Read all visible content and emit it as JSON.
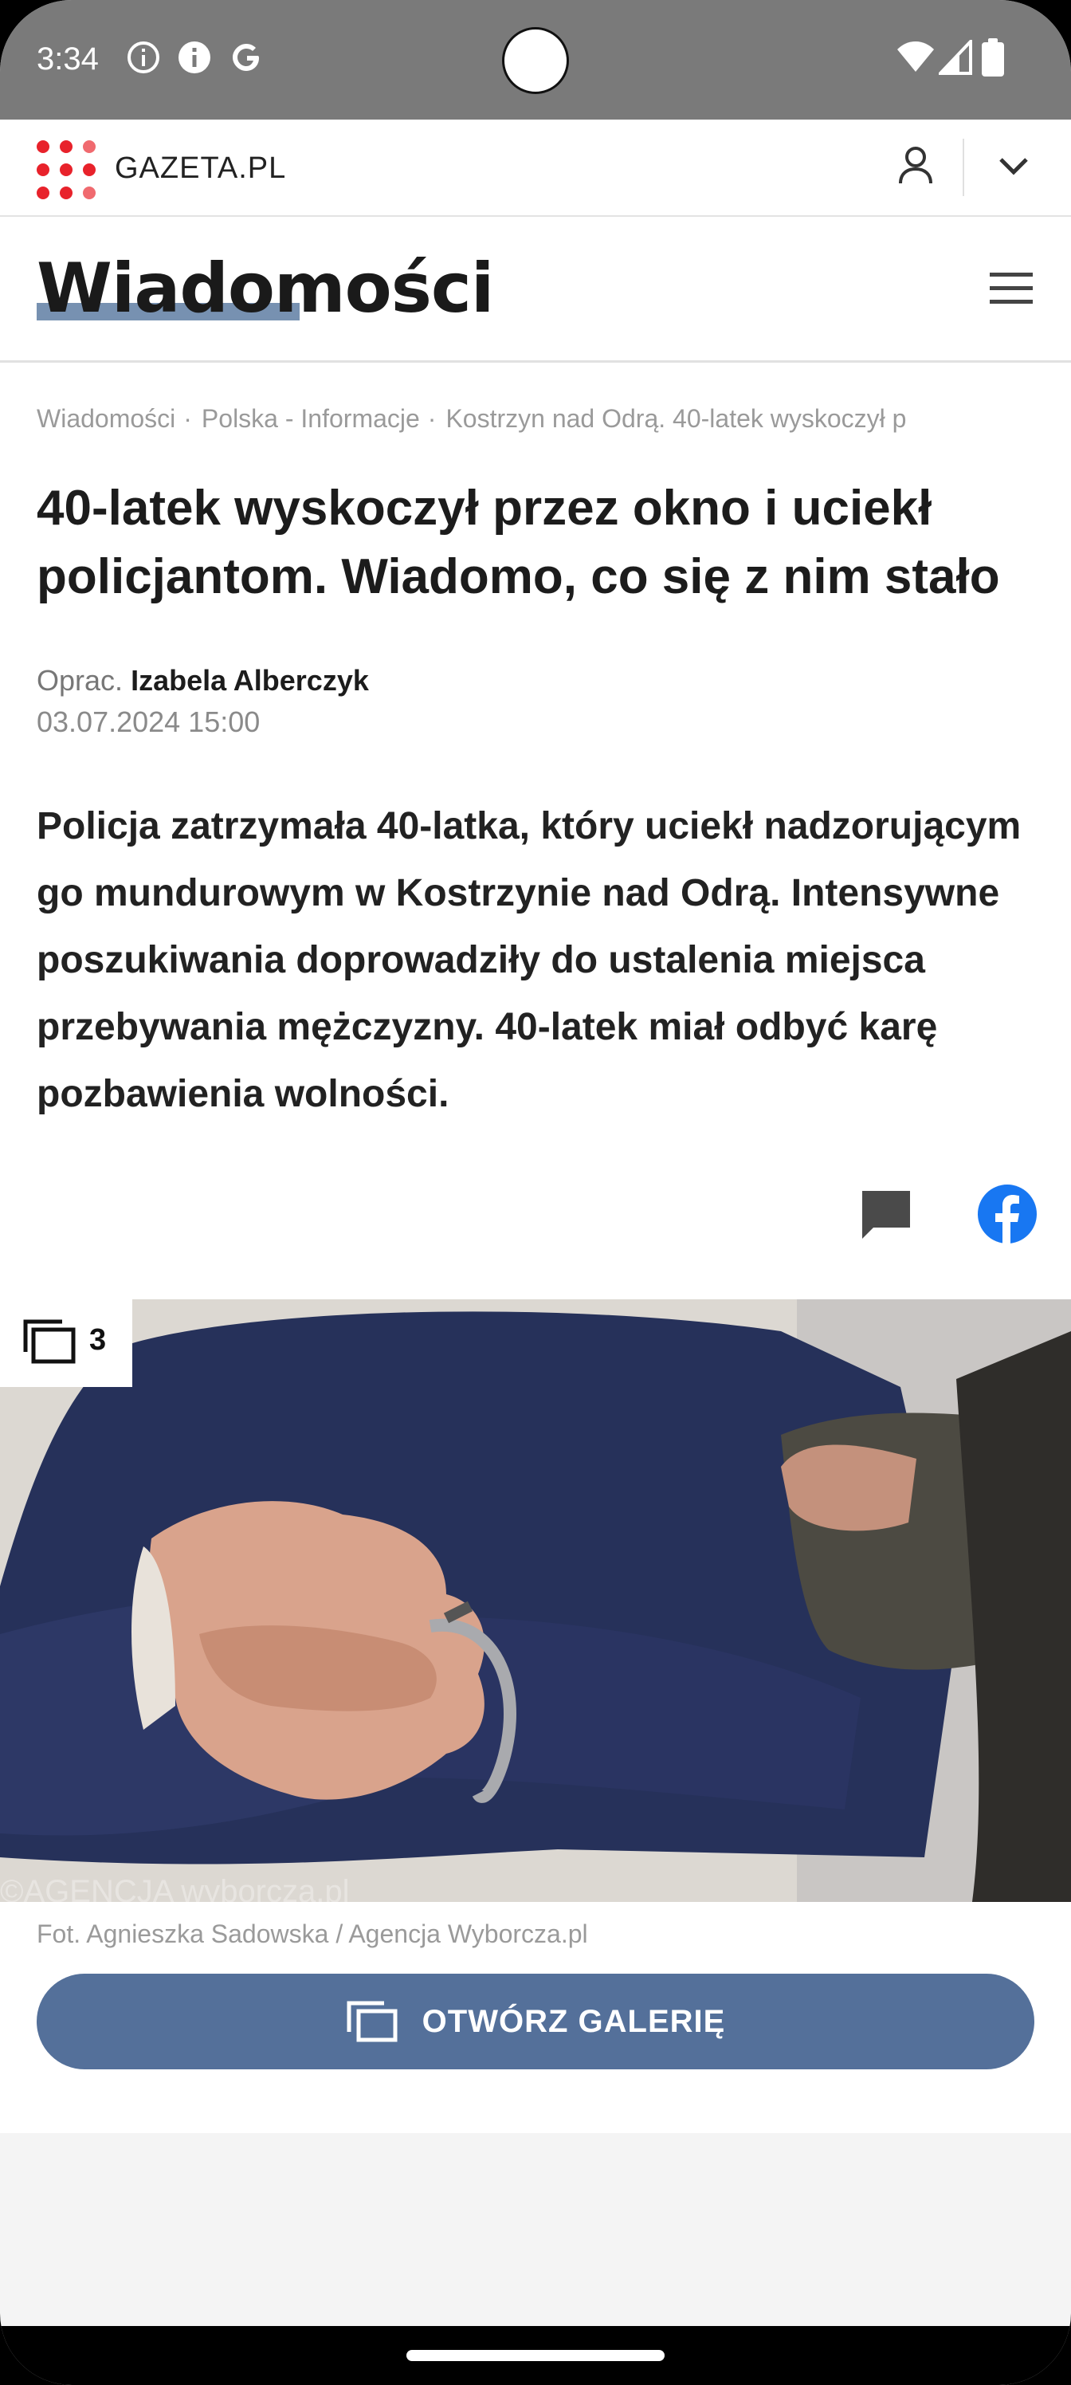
{
  "status_bar": {
    "time": "3:34",
    "icons": [
      "info-outline-icon",
      "info-filled-icon",
      "google-icon",
      "wifi-icon",
      "signal-icon",
      "battery-icon"
    ]
  },
  "brand": {
    "name": "GAZETA.PL",
    "logo_color": "#e8222b",
    "icons": [
      "user-icon",
      "chevron-down-icon"
    ]
  },
  "section": {
    "title": "Wiadomości",
    "accent": "#5f7ea3",
    "menu_icon": "hamburger-menu-icon"
  },
  "article": {
    "breadcrumb": [
      "Wiadomości",
      "Polska - Informacje",
      "Kostrzyn nad Odrą. 40-latek wyskoczył p"
    ],
    "breadcrumb_separator": "·",
    "headline": "40-latek wyskoczył przez okno i uciekł policjantom. Wiadomo, co się z nim stało",
    "byline_prefix": "Oprac.",
    "author": "Izabela Alberczyk",
    "date": "03.07.2024 15:00",
    "lead": "Policja zatrzymała 40-latka, który uciekł nadzorującym go mundurowym w Kostrzynie nad Odrą. Intensywne poszukiwania doprowadziły do ustalenia miejsca przebywania mężczyzny. 40-latek miał odbyć karę pozbawienia wolności.",
    "share_icons": [
      "comment-icon",
      "facebook-icon"
    ],
    "facebook_color": "#1877f2"
  },
  "photo": {
    "gallery_count": "3",
    "watermark": "©AGENCJA wyborcza.pl",
    "caption": "Fot. Agnieszka Sadowska / Agencja Wyborcza.pl"
  },
  "gallery_button": {
    "label": "OTWÓRZ GALERIĘ",
    "color": "#54709a"
  }
}
